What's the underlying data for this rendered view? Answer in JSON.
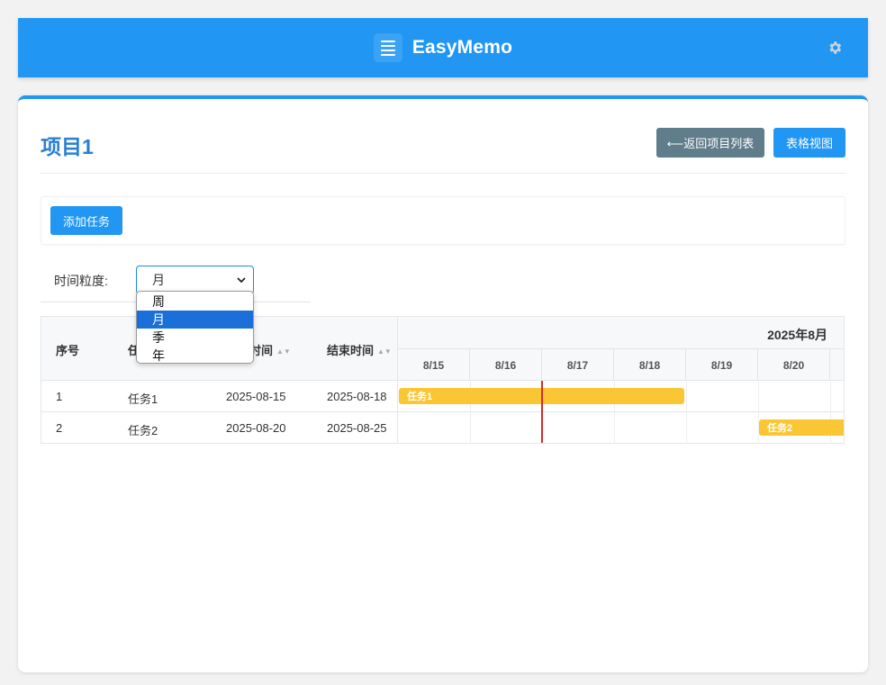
{
  "app": {
    "title": "EasyMemo"
  },
  "icons": {
    "logo": "menu-lines-icon",
    "settings": "gear-icon",
    "select": "chevron-down-icon"
  },
  "colors": {
    "primary": "#2196f3",
    "secondary": "#607d8b",
    "bar": "#fbc634",
    "today_line": "#d62a2a",
    "title": "#2a7fd4"
  },
  "project": {
    "title": "项目1"
  },
  "actions": {
    "back_label": "⟵返回项目列表",
    "table_view_label": "表格视图",
    "add_task_label": "添加任务"
  },
  "granularity": {
    "label": "时间粒度:",
    "selected": "月",
    "options": [
      "周",
      "月",
      "季",
      "年"
    ]
  },
  "gantt": {
    "columns": [
      {
        "label": "序号"
      },
      {
        "label": "任务"
      },
      {
        "label": "开始时间"
      },
      {
        "label": "结束时间"
      }
    ],
    "month_label": "2025年8月",
    "days": [
      "8/15",
      "8/16",
      "8/17",
      "8/18",
      "8/19",
      "8/20"
    ],
    "rows": [
      {
        "index": "1",
        "name": "任务1",
        "start": "2025-08-15",
        "end": "2025-08-18",
        "bar_label": "任务1"
      },
      {
        "index": "2",
        "name": "任务2",
        "start": "2025-08-20",
        "end": "2025-08-25",
        "bar_label": "任务2"
      }
    ]
  }
}
